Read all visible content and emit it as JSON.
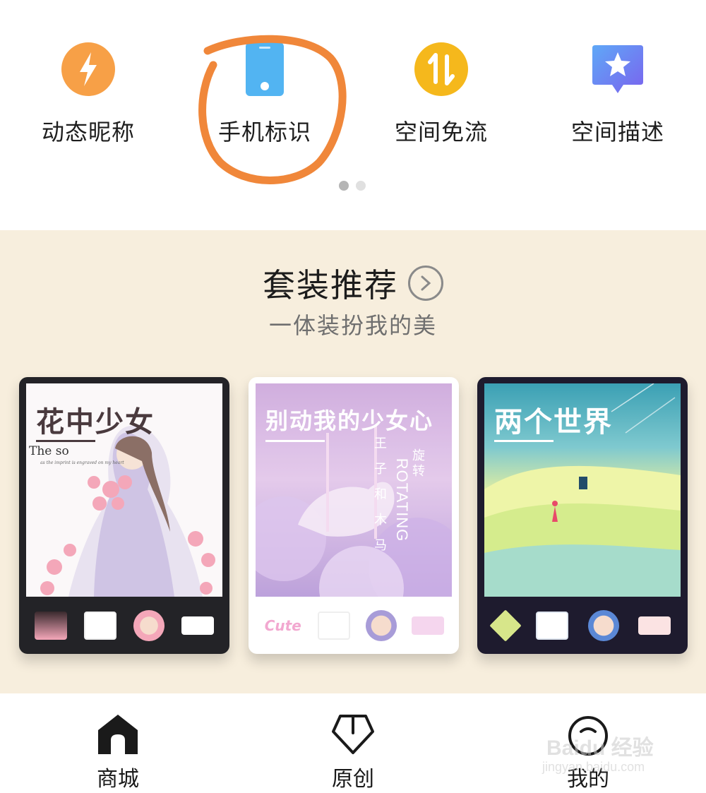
{
  "features": [
    {
      "label": "动态昵称",
      "icon": "lightning-icon",
      "color": "#f7a047"
    },
    {
      "label": "手机标识",
      "icon": "phone-icon",
      "color": "#52b4f2"
    },
    {
      "label": "空间免流",
      "icon": "data-transfer-icon",
      "color": "#f5b81c"
    },
    {
      "label": "空间描述",
      "icon": "star-bubble-icon",
      "color": "#6b7cf0"
    }
  ],
  "pager": {
    "pages": 2,
    "active": 1
  },
  "annotation_color": "#f0873a",
  "suit": {
    "title": "套装推荐",
    "subtitle": "一体装扮我的美",
    "cards": [
      {
        "title": "花中少女",
        "art_text_1": "The so",
        "art_text_2": "as the imprint is engraved on my heart"
      },
      {
        "title": "别动我的少女心",
        "art_text_1": "旋转",
        "art_text_2": "ROTATING",
        "art_text_3": "王子和木马"
      },
      {
        "title": "两个世界"
      }
    ],
    "card2_badge": "Cute"
  },
  "nav": [
    {
      "label": "商城",
      "icon": "home-icon",
      "active": true
    },
    {
      "label": "原创",
      "icon": "pentagon-icon",
      "active": false
    },
    {
      "label": "我的",
      "icon": "profile-icon",
      "active": false
    }
  ],
  "watermark": {
    "brand": "Baidu 经验",
    "url": "jingyan.baidu.com"
  }
}
